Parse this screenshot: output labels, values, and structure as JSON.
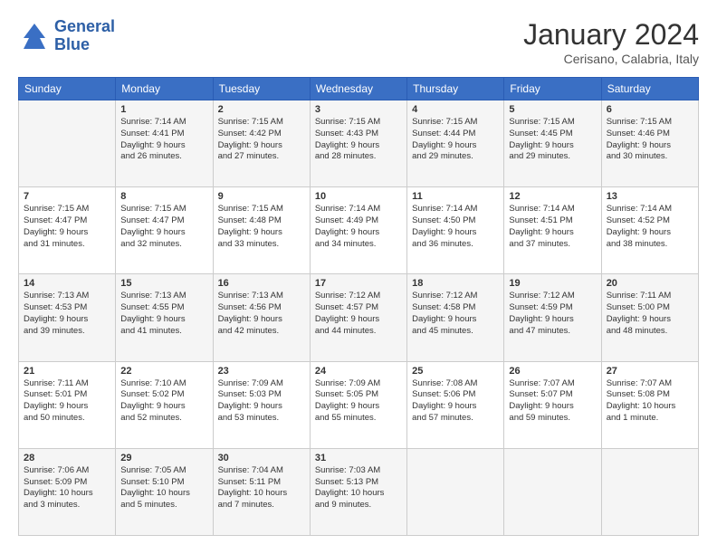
{
  "header": {
    "logo_line1": "General",
    "logo_line2": "Blue",
    "month": "January 2024",
    "location": "Cerisano, Calabria, Italy"
  },
  "days_of_week": [
    "Sunday",
    "Monday",
    "Tuesday",
    "Wednesday",
    "Thursday",
    "Friday",
    "Saturday"
  ],
  "weeks": [
    [
      {
        "day": "",
        "info": ""
      },
      {
        "day": "1",
        "info": "Sunrise: 7:14 AM\nSunset: 4:41 PM\nDaylight: 9 hours\nand 26 minutes."
      },
      {
        "day": "2",
        "info": "Sunrise: 7:15 AM\nSunset: 4:42 PM\nDaylight: 9 hours\nand 27 minutes."
      },
      {
        "day": "3",
        "info": "Sunrise: 7:15 AM\nSunset: 4:43 PM\nDaylight: 9 hours\nand 28 minutes."
      },
      {
        "day": "4",
        "info": "Sunrise: 7:15 AM\nSunset: 4:44 PM\nDaylight: 9 hours\nand 29 minutes."
      },
      {
        "day": "5",
        "info": "Sunrise: 7:15 AM\nSunset: 4:45 PM\nDaylight: 9 hours\nand 29 minutes."
      },
      {
        "day": "6",
        "info": "Sunrise: 7:15 AM\nSunset: 4:46 PM\nDaylight: 9 hours\nand 30 minutes."
      }
    ],
    [
      {
        "day": "7",
        "info": "Sunrise: 7:15 AM\nSunset: 4:47 PM\nDaylight: 9 hours\nand 31 minutes."
      },
      {
        "day": "8",
        "info": "Sunrise: 7:15 AM\nSunset: 4:47 PM\nDaylight: 9 hours\nand 32 minutes."
      },
      {
        "day": "9",
        "info": "Sunrise: 7:15 AM\nSunset: 4:48 PM\nDaylight: 9 hours\nand 33 minutes."
      },
      {
        "day": "10",
        "info": "Sunrise: 7:14 AM\nSunset: 4:49 PM\nDaylight: 9 hours\nand 34 minutes."
      },
      {
        "day": "11",
        "info": "Sunrise: 7:14 AM\nSunset: 4:50 PM\nDaylight: 9 hours\nand 36 minutes."
      },
      {
        "day": "12",
        "info": "Sunrise: 7:14 AM\nSunset: 4:51 PM\nDaylight: 9 hours\nand 37 minutes."
      },
      {
        "day": "13",
        "info": "Sunrise: 7:14 AM\nSunset: 4:52 PM\nDaylight: 9 hours\nand 38 minutes."
      }
    ],
    [
      {
        "day": "14",
        "info": "Sunrise: 7:13 AM\nSunset: 4:53 PM\nDaylight: 9 hours\nand 39 minutes."
      },
      {
        "day": "15",
        "info": "Sunrise: 7:13 AM\nSunset: 4:55 PM\nDaylight: 9 hours\nand 41 minutes."
      },
      {
        "day": "16",
        "info": "Sunrise: 7:13 AM\nSunset: 4:56 PM\nDaylight: 9 hours\nand 42 minutes."
      },
      {
        "day": "17",
        "info": "Sunrise: 7:12 AM\nSunset: 4:57 PM\nDaylight: 9 hours\nand 44 minutes."
      },
      {
        "day": "18",
        "info": "Sunrise: 7:12 AM\nSunset: 4:58 PM\nDaylight: 9 hours\nand 45 minutes."
      },
      {
        "day": "19",
        "info": "Sunrise: 7:12 AM\nSunset: 4:59 PM\nDaylight: 9 hours\nand 47 minutes."
      },
      {
        "day": "20",
        "info": "Sunrise: 7:11 AM\nSunset: 5:00 PM\nDaylight: 9 hours\nand 48 minutes."
      }
    ],
    [
      {
        "day": "21",
        "info": "Sunrise: 7:11 AM\nSunset: 5:01 PM\nDaylight: 9 hours\nand 50 minutes."
      },
      {
        "day": "22",
        "info": "Sunrise: 7:10 AM\nSunset: 5:02 PM\nDaylight: 9 hours\nand 52 minutes."
      },
      {
        "day": "23",
        "info": "Sunrise: 7:09 AM\nSunset: 5:03 PM\nDaylight: 9 hours\nand 53 minutes."
      },
      {
        "day": "24",
        "info": "Sunrise: 7:09 AM\nSunset: 5:05 PM\nDaylight: 9 hours\nand 55 minutes."
      },
      {
        "day": "25",
        "info": "Sunrise: 7:08 AM\nSunset: 5:06 PM\nDaylight: 9 hours\nand 57 minutes."
      },
      {
        "day": "26",
        "info": "Sunrise: 7:07 AM\nSunset: 5:07 PM\nDaylight: 9 hours\nand 59 minutes."
      },
      {
        "day": "27",
        "info": "Sunrise: 7:07 AM\nSunset: 5:08 PM\nDaylight: 10 hours\nand 1 minute."
      }
    ],
    [
      {
        "day": "28",
        "info": "Sunrise: 7:06 AM\nSunset: 5:09 PM\nDaylight: 10 hours\nand 3 minutes."
      },
      {
        "day": "29",
        "info": "Sunrise: 7:05 AM\nSunset: 5:10 PM\nDaylight: 10 hours\nand 5 minutes."
      },
      {
        "day": "30",
        "info": "Sunrise: 7:04 AM\nSunset: 5:11 PM\nDaylight: 10 hours\nand 7 minutes."
      },
      {
        "day": "31",
        "info": "Sunrise: 7:03 AM\nSunset: 5:13 PM\nDaylight: 10 hours\nand 9 minutes."
      },
      {
        "day": "",
        "info": ""
      },
      {
        "day": "",
        "info": ""
      },
      {
        "day": "",
        "info": ""
      }
    ]
  ]
}
